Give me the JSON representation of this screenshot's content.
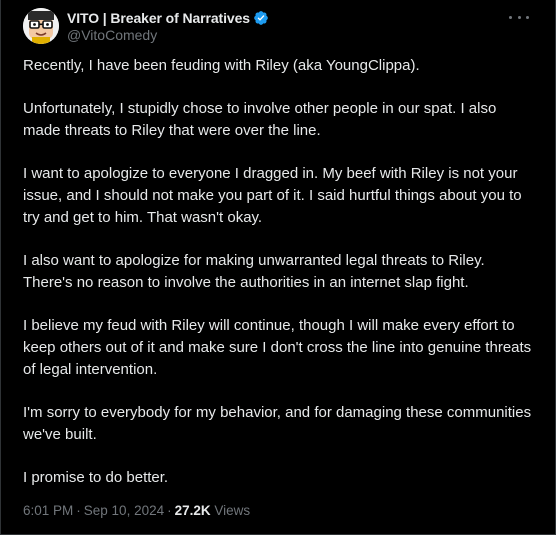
{
  "author": {
    "display_name": "VITO | Breaker of Narratives",
    "handle": "@VitoComedy",
    "verified": true,
    "verified_color": "#1d9bf0",
    "avatar_icon": "cartoon-face-with-glasses-avatar"
  },
  "tweet": {
    "paragraphs": [
      "Recently, I have been feuding with Riley (aka YoungClippa).",
      "Unfortunately, I stupidly chose to involve other people in our spat. I also made threats to Riley that were over the line.",
      "I want to apologize to everyone I dragged in. My beef with Riley is not your issue, and I should not make you part of it. I said hurtful things about you to try and get to him. That wasn't okay.",
      "I also want to apologize for making unwarranted legal threats to Riley. There's no reason to involve the authorities in an internet slap fight.",
      "I believe my feud with Riley will continue, though I will make every effort to keep others out of it and make sure I don't cross the line into genuine threats of legal intervention.",
      "I'm sorry to everybody for my behavior, and for damaging these communities we've built.",
      "I promise to do better."
    ],
    "time": "6:01 PM",
    "separator": "·",
    "date": "Sep 10, 2024",
    "views_count": "27.2K",
    "views_label": "Views"
  },
  "icons": {
    "more": "more-horizontal-icon",
    "verified": "verified-badge-icon"
  },
  "colors": {
    "background": "#000000",
    "text": "#e7e9ea",
    "secondary_text": "#71767b",
    "border": "#2f3336"
  }
}
